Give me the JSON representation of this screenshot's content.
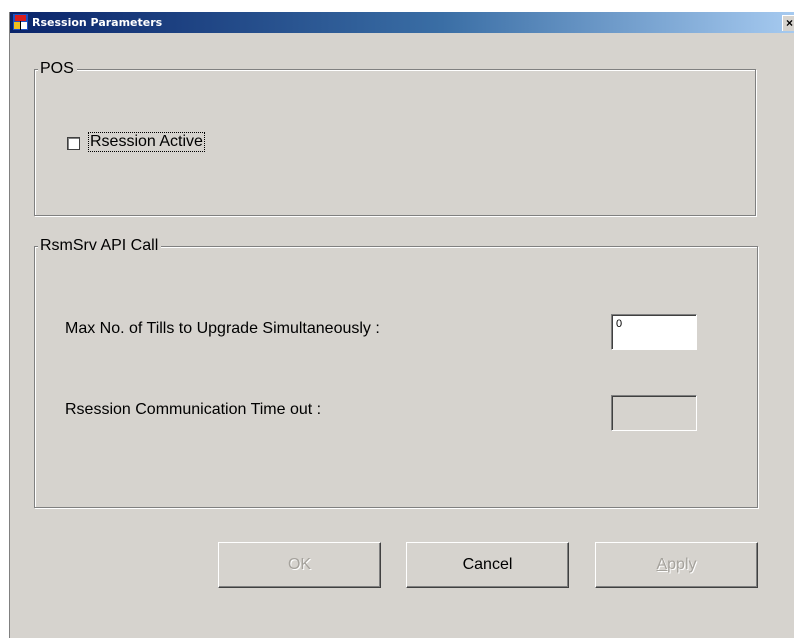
{
  "window": {
    "title": "Rsession Parameters",
    "close_glyph": "×"
  },
  "pos_group": {
    "legend": "POS",
    "checkbox_label": "Rsession Active",
    "checked": false
  },
  "api_group": {
    "legend": "RsmSrv API Call",
    "max_tills_label": "Max No. of Tills to Upgrade Simultaneously  :",
    "max_tills_value": "0",
    "timeout_label": "Rsession Communication Time out :",
    "timeout_value": ""
  },
  "buttons": {
    "ok": "OK",
    "cancel": "Cancel",
    "apply_accel": "A",
    "apply_rest": "pply"
  },
  "colors": {
    "dialog_bg": "#d6d3ce",
    "title_start": "#0a246a",
    "title_end": "#a6caf0"
  }
}
